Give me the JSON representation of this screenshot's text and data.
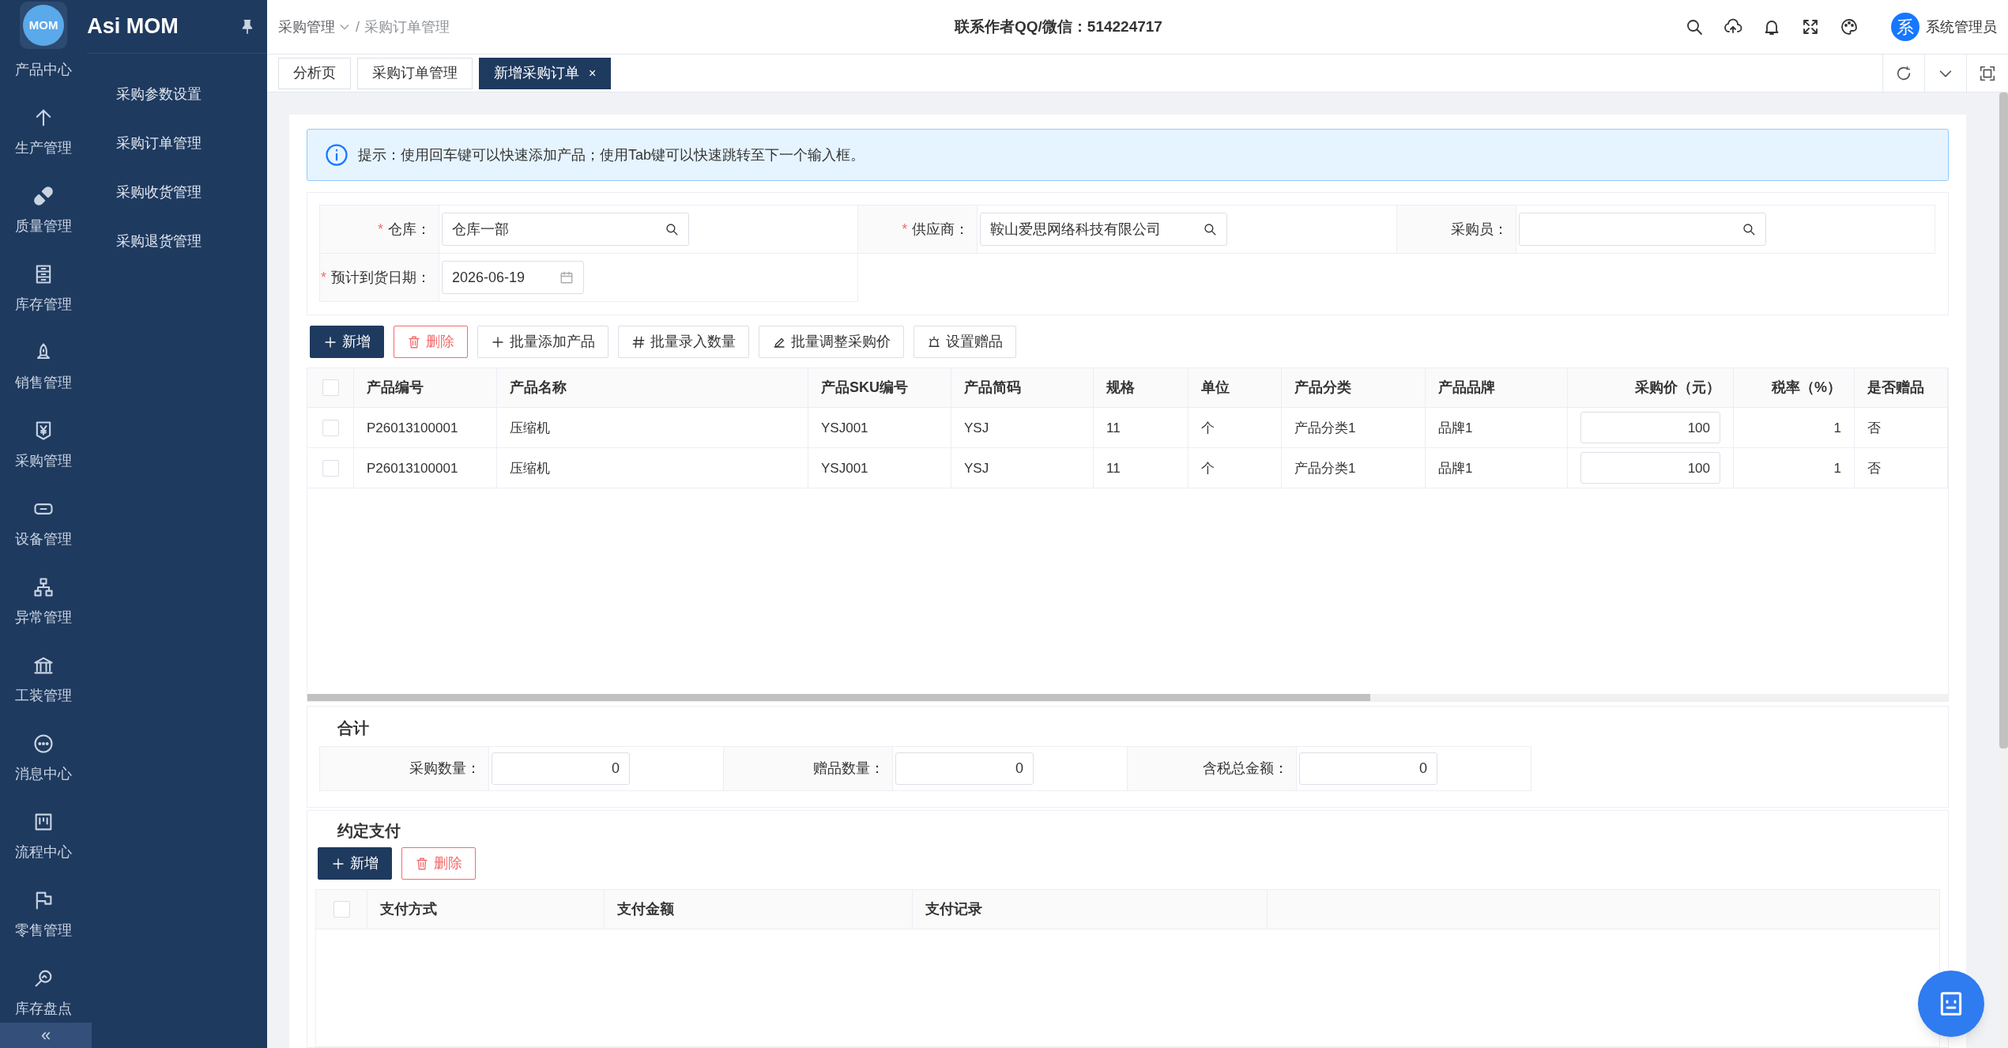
{
  "sidebar": {
    "logo_text": "MOM",
    "app_name": "Asi MOM",
    "rail_items": [
      {
        "label": "产品中心"
      },
      {
        "label": "生产管理"
      },
      {
        "label": "质量管理"
      },
      {
        "label": "库存管理"
      },
      {
        "label": "销售管理"
      },
      {
        "label": "采购管理"
      },
      {
        "label": "设备管理"
      },
      {
        "label": "异常管理"
      },
      {
        "label": "工装管理"
      },
      {
        "label": "消息中心"
      },
      {
        "label": "流程中心"
      },
      {
        "label": "零售管理"
      },
      {
        "label": "库存盘点"
      }
    ],
    "collapse_mark": "«",
    "submenu": [
      "采购参数设置",
      "采购订单管理",
      "采购收货管理",
      "采购退货管理"
    ]
  },
  "breadcrumb": {
    "items": [
      {
        "label": "采购管理",
        "dropdown": true
      },
      {
        "label": "采购订单管理",
        "dropdown": false
      }
    ],
    "separator": "/"
  },
  "header_notice": "联系作者QQ/微信：514224717",
  "user": {
    "avatar_text": "系",
    "name": "系统管理员"
  },
  "tabs": [
    {
      "label": "分析页",
      "selected": false
    },
    {
      "label": "采购订单管理",
      "selected": false
    },
    {
      "label": "新增采购订单",
      "selected": true,
      "close_mark": "×"
    }
  ],
  "alert": {
    "text": "提示：使用回车键可以快速添加产品；使用Tab键可以快速跳转至下一个输入框。"
  },
  "form": {
    "fields": [
      {
        "label": "仓库：",
        "required_mark": "*",
        "kind": "search",
        "value": "仓库一部"
      },
      {
        "label": "供应商：",
        "required_mark": "*",
        "kind": "search",
        "value": "鞍山爱思网络科技有限公司"
      },
      {
        "label": "采购员：",
        "kind": "search"
      },
      {
        "label": "预计到货日期：",
        "required_mark": "*",
        "kind": "date",
        "value": "2026-06-19"
      }
    ]
  },
  "toolbar": [
    {
      "label": "新增",
      "kind": "primary"
    },
    {
      "label": "删除",
      "kind": "danger"
    },
    {
      "label": "批量添加产品",
      "kind": "default"
    },
    {
      "label": "批量录入数量",
      "kind": "default"
    },
    {
      "label": "批量调整采购价",
      "kind": "default"
    },
    {
      "label": "设置赠品",
      "kind": "default"
    }
  ],
  "table": {
    "header_checked": false,
    "columns": [
      {
        "label": "产品编号",
        "kind": "text"
      },
      {
        "label": "产品名称",
        "kind": "text"
      },
      {
        "label": "产品SKU编号",
        "kind": "text"
      },
      {
        "label": "产品简码",
        "kind": "text"
      },
      {
        "label": "规格",
        "kind": "text"
      },
      {
        "label": "单位",
        "kind": "text"
      },
      {
        "label": "产品分类",
        "kind": "text"
      },
      {
        "label": "产品品牌",
        "kind": "text"
      },
      {
        "label": "采购价（元）",
        "kind": "input"
      },
      {
        "label": "税率（%）",
        "kind": "number"
      },
      {
        "label": "是否赠品",
        "kind": "text"
      }
    ],
    "rows": [
      {
        "checked": false,
        "cells": [
          "P26013100001",
          "压缩机",
          "YSJ001",
          "YSJ",
          "11",
          "个",
          "产品分类1",
          "品牌1",
          "100",
          "1",
          "否"
        ]
      },
      {
        "checked": false,
        "cells": [
          "P26013100001",
          "压缩机",
          "YSJ001",
          "YSJ",
          "11",
          "个",
          "产品分类1",
          "品牌1",
          "100",
          "1",
          "否"
        ]
      }
    ]
  },
  "summary": {
    "title": "合计",
    "fields": [
      {
        "label": "采购数量：",
        "value": "0"
      },
      {
        "label": "赠品数量：",
        "value": "0"
      },
      {
        "label": "含税总金额：",
        "value": "0"
      }
    ]
  },
  "payment": {
    "title": "约定支付",
    "buttons": [
      {
        "label": "新增",
        "kind": "primary"
      },
      {
        "label": "删除",
        "kind": "danger"
      }
    ],
    "table": {
      "header_checked": false,
      "columns": [
        "支付方式",
        "支付金额",
        "支付记录"
      ]
    }
  }
}
